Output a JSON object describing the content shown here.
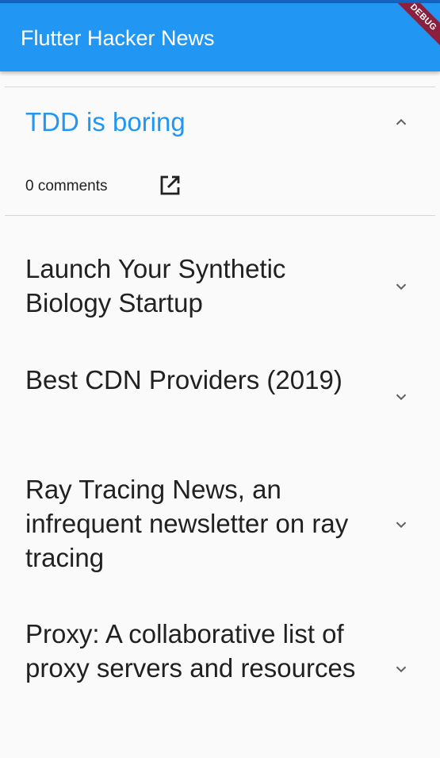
{
  "app_bar": {
    "title": "Flutter Hacker News",
    "debug_banner": "DEBUG",
    "color": "#2196f3"
  },
  "stories": [
    {
      "title": "TDD is boring",
      "expanded": true,
      "comments_label": "0 comments",
      "icon": "open-in-new-icon",
      "chevron": "chevron-up-icon"
    },
    {
      "title": "Launch Your Synthetic Biology Startup",
      "expanded": false,
      "chevron": "chevron-down-icon"
    },
    {
      "title": "Best CDN Providers (2019)",
      "expanded": false,
      "chevron": "chevron-down-icon"
    },
    {
      "title": "Ray Tracing News, an infrequent newsletter on ray tracing",
      "expanded": false,
      "chevron": "chevron-down-icon"
    },
    {
      "title": "Proxy: A collaborative list of proxy servers and resources",
      "expanded": false,
      "chevron": "chevron-down-icon"
    }
  ]
}
